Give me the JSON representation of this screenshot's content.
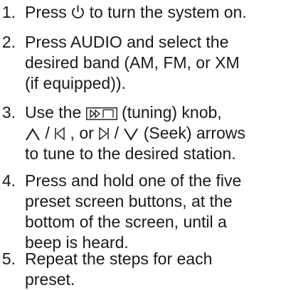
{
  "steps": [
    {
      "number": "1.",
      "parts": {
        "a": "Press ",
        "power_icon": "power-icon",
        "b": " to turn the system on."
      }
    },
    {
      "number": "2.",
      "lines": [
        "Press AUDIO and select the",
        "desired band (AM, FM, or XM",
        "(if equipped))."
      ]
    },
    {
      "number": "3.",
      "parts": {
        "a": "Use the ",
        "tuning_icon": "tuning-knob-icon",
        "b": " (tuning) knob,",
        "up_icon": "caret-up-icon",
        "c": " / ",
        "prev_icon": "seek-back-icon",
        "d": " , or ",
        "next_icon": "seek-forward-icon",
        "e": " / ",
        "down_icon": "caret-down-icon",
        "f": " (Seek) arrows",
        "g": "to tune to the desired station."
      }
    },
    {
      "number": "4.",
      "lines": [
        "Press and hold one of the five",
        "preset screen buttons, at the",
        "bottom of the screen, until a",
        "beep is heard."
      ]
    },
    {
      "number": "5.",
      "lines": [
        "Repeat the steps for each",
        "preset."
      ]
    }
  ]
}
